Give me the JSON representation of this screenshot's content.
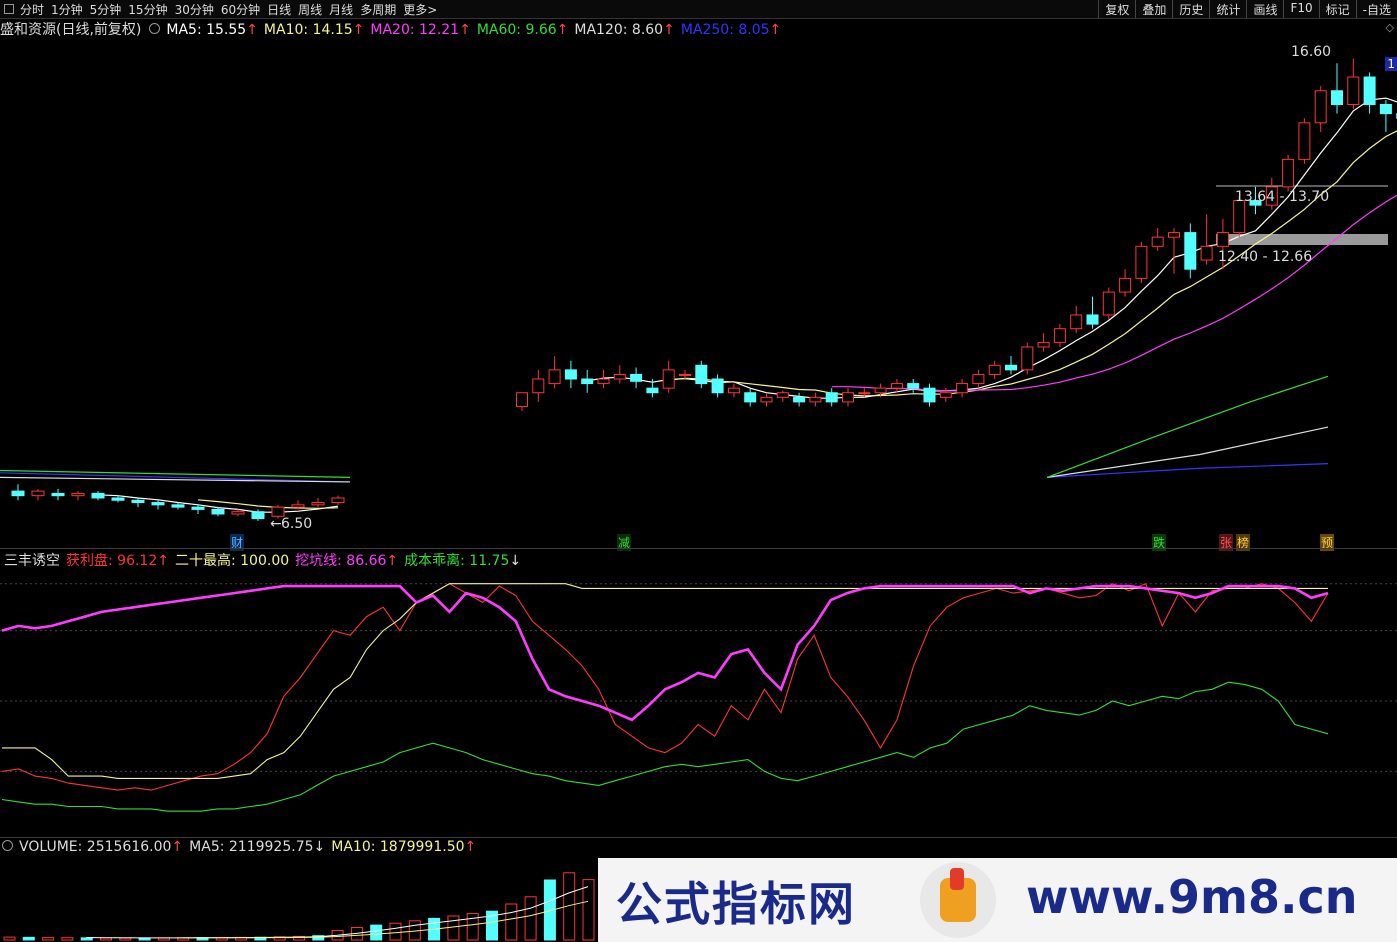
{
  "toolbar": {
    "tabs": [
      "分时",
      "1分钟",
      "5分钟",
      "15分钟",
      "30分钟",
      "60分钟",
      "日线",
      "周线",
      "月线",
      "多周期",
      "更多>"
    ],
    "active_tab": "日线",
    "right_tools": [
      "复权",
      "叠加",
      "历史",
      "统计",
      "画线",
      "F10",
      "标记",
      "-自选"
    ]
  },
  "price_pane": {
    "title": "盛和资源(日线,前复权)",
    "ma": [
      {
        "label": "MA5: 15.55",
        "arrow": "↑",
        "color": "#ffffff"
      },
      {
        "label": "MA10: 14.15",
        "arrow": "↑",
        "color": "#f5f58a"
      },
      {
        "label": "MA20: 12.21",
        "arrow": "↑",
        "color": "#ff3cff"
      },
      {
        "label": "MA60: 9.66",
        "arrow": "↑",
        "color": "#33dd33"
      },
      {
        "label": "MA120: 8.60",
        "arrow": "↑",
        "color": "#dddddd"
      },
      {
        "label": "MA250: 8.05",
        "arrow": "↑",
        "color": "#3333ff"
      }
    ],
    "high_label": "16.60",
    "low_label": "6.50",
    "zone1": "13.64 - 13.70",
    "zone2": "12.40 - 12.66",
    "right_edge_label": "1"
  },
  "events": [
    {
      "text": "财",
      "color": "#5ab4ff"
    },
    {
      "text": "减",
      "color": "#33dd33"
    },
    {
      "text": "跌",
      "color": "#33dd33"
    },
    {
      "text": "张",
      "color": "#ff5555"
    },
    {
      "text": "榜",
      "color": "#ffcc33"
    },
    {
      "text": "预",
      "color": "#ffcc33"
    }
  ],
  "indicator_pane": {
    "name": "三丰诱空",
    "items": [
      {
        "label": "获利盘: 96.12",
        "arrow": "↑",
        "color": "#ff3333"
      },
      {
        "label": "二十最高: 100.00",
        "arrow": "",
        "color": "#f5f58a"
      },
      {
        "label": "挖坑线: 86.66",
        "arrow": "↑",
        "color": "#ff3cff"
      },
      {
        "label": "成本乖离: 11.75",
        "arrow": "↓",
        "color": "#33dd33"
      }
    ]
  },
  "volume_pane": {
    "items": [
      {
        "label": "VOLUME: 2515616.00",
        "arrow": "↑",
        "color": "#dddddd"
      },
      {
        "label": "MA5: 2119925.75",
        "arrow": "↓",
        "color": "#dddddd"
      },
      {
        "label": "MA10: 1879991.50",
        "arrow": "↑",
        "color": "#f5f58a"
      }
    ]
  },
  "watermark": {
    "left_text": "公式指标网",
    "right_text": "www.9m8.cn",
    "logo_text": "www.9m8.cn"
  },
  "colors": {
    "up": "#ff3333",
    "down": "#54ffff",
    "ma5": "#ffffff",
    "ma10": "#f5f58a",
    "ma20": "#ff3cff",
    "ma60": "#33dd33",
    "ma120": "#dddddd",
    "ma250": "#3333ff"
  },
  "chart_data": [
    {
      "type": "candlestick",
      "title": "盛和资源(日线,前复权)",
      "candles": [
        {
          "o": 7.15,
          "h": 7.3,
          "c": 7.05,
          "l": 6.95
        },
        {
          "o": 7.05,
          "h": 7.2,
          "c": 7.15,
          "l": 6.95
        },
        {
          "o": 7.1,
          "h": 7.2,
          "c": 7.05,
          "l": 6.95
        },
        {
          "o": 7.05,
          "h": 7.15,
          "c": 7.1,
          "l": 6.95
        },
        {
          "o": 7.1,
          "h": 7.15,
          "c": 7.0,
          "l": 6.95
        },
        {
          "o": 7.0,
          "h": 7.05,
          "c": 6.95,
          "l": 6.9
        },
        {
          "o": 6.95,
          "h": 7.0,
          "c": 6.9,
          "l": 6.8
        },
        {
          "o": 6.9,
          "h": 6.95,
          "c": 6.85,
          "l": 6.75
        },
        {
          "o": 6.85,
          "h": 6.9,
          "c": 6.8,
          "l": 6.75
        },
        {
          "o": 6.8,
          "h": 6.85,
          "c": 6.75,
          "l": 6.65
        },
        {
          "o": 6.75,
          "h": 6.8,
          "c": 6.65,
          "l": 6.6
        },
        {
          "o": 6.65,
          "h": 6.75,
          "c": 6.7,
          "l": 6.6
        },
        {
          "o": 6.7,
          "h": 6.75,
          "c": 6.55,
          "l": 6.5
        },
        {
          "o": 6.6,
          "h": 6.85,
          "c": 6.8,
          "l": 6.55
        },
        {
          "o": 6.8,
          "h": 6.95,
          "c": 6.85,
          "l": 6.75
        },
        {
          "o": 6.85,
          "h": 7.0,
          "c": 6.9,
          "l": 6.8
        },
        {
          "o": 6.9,
          "h": 7.05,
          "c": 7.0,
          "l": 6.85
        },
        {
          "o": 9.0,
          "h": 9.2,
          "c": 9.3,
          "l": 8.9
        },
        {
          "o": 9.3,
          "h": 9.8,
          "c": 9.6,
          "l": 9.1
        },
        {
          "o": 9.5,
          "h": 10.1,
          "c": 9.8,
          "l": 9.4
        },
        {
          "o": 9.8,
          "h": 10.0,
          "c": 9.6,
          "l": 9.4
        },
        {
          "o": 9.6,
          "h": 9.8,
          "c": 9.5,
          "l": 9.3
        },
        {
          "o": 9.5,
          "h": 9.8,
          "c": 9.6,
          "l": 9.4
        },
        {
          "o": 9.6,
          "h": 9.9,
          "c": 9.7,
          "l": 9.5
        },
        {
          "o": 9.7,
          "h": 9.85,
          "c": 9.55,
          "l": 9.4
        },
        {
          "o": 9.4,
          "h": 9.6,
          "c": 9.3,
          "l": 9.2
        },
        {
          "o": 9.4,
          "h": 10.0,
          "c": 9.8,
          "l": 9.3
        },
        {
          "o": 9.7,
          "h": 9.8,
          "c": 9.7,
          "l": 9.6
        },
        {
          "o": 9.9,
          "h": 10.0,
          "c": 9.5,
          "l": 9.4
        },
        {
          "o": 9.6,
          "h": 9.7,
          "c": 9.3,
          "l": 9.2
        },
        {
          "o": 9.3,
          "h": 9.5,
          "c": 9.4,
          "l": 9.2
        },
        {
          "o": 9.3,
          "h": 9.4,
          "c": 9.1,
          "l": 9.0
        },
        {
          "o": 9.1,
          "h": 9.3,
          "c": 9.2,
          "l": 9.0
        },
        {
          "o": 9.2,
          "h": 9.35,
          "c": 9.3,
          "l": 9.1
        },
        {
          "o": 9.2,
          "h": 9.3,
          "c": 9.1,
          "l": 9.0
        },
        {
          "o": 9.1,
          "h": 9.3,
          "c": 9.2,
          "l": 9.0
        },
        {
          "o": 9.3,
          "h": 9.4,
          "c": 9.1,
          "l": 9.0
        },
        {
          "o": 9.1,
          "h": 9.4,
          "c": 9.3,
          "l": 9.0
        },
        {
          "o": 9.3,
          "h": 9.4,
          "c": 9.3,
          "l": 9.2
        },
        {
          "o": 9.3,
          "h": 9.5,
          "c": 9.4,
          "l": 9.2
        },
        {
          "o": 9.4,
          "h": 9.6,
          "c": 9.5,
          "l": 9.3
        },
        {
          "o": 9.5,
          "h": 9.6,
          "c": 9.4,
          "l": 9.3
        },
        {
          "o": 9.4,
          "h": 9.5,
          "c": 9.1,
          "l": 9.0
        },
        {
          "o": 9.2,
          "h": 9.4,
          "c": 9.3,
          "l": 9.1
        },
        {
          "o": 9.3,
          "h": 9.6,
          "c": 9.5,
          "l": 9.2
        },
        {
          "o": 9.5,
          "h": 9.8,
          "c": 9.7,
          "l": 9.4
        },
        {
          "o": 9.7,
          "h": 10.0,
          "c": 9.9,
          "l": 9.6
        },
        {
          "o": 9.9,
          "h": 10.1,
          "c": 9.8,
          "l": 9.7
        },
        {
          "o": 9.8,
          "h": 10.4,
          "c": 10.3,
          "l": 9.7
        },
        {
          "o": 10.3,
          "h": 10.6,
          "c": 10.4,
          "l": 10.2
        },
        {
          "o": 10.4,
          "h": 10.8,
          "c": 10.7,
          "l": 10.3
        },
        {
          "o": 10.7,
          "h": 11.2,
          "c": 11.0,
          "l": 10.6
        },
        {
          "o": 11.0,
          "h": 11.4,
          "c": 10.8,
          "l": 10.7
        },
        {
          "o": 11.0,
          "h": 11.6,
          "c": 11.5,
          "l": 10.9
        },
        {
          "o": 11.5,
          "h": 12.0,
          "c": 11.8,
          "l": 11.4
        },
        {
          "o": 11.8,
          "h": 12.6,
          "c": 12.5,
          "l": 11.7
        },
        {
          "o": 12.5,
          "h": 12.9,
          "c": 12.7,
          "l": 12.4
        },
        {
          "o": 12.7,
          "h": 12.9,
          "c": 12.8,
          "l": 11.9
        },
        {
          "o": 12.8,
          "h": 13.0,
          "c": 12.0,
          "l": 11.8
        },
        {
          "o": 12.2,
          "h": 13.2,
          "c": 12.5,
          "l": 12.1
        },
        {
          "o": 12.5,
          "h": 13.1,
          "c": 12.8,
          "l": 12.0
        },
        {
          "o": 12.8,
          "h": 13.6,
          "c": 13.5,
          "l": 12.7
        },
        {
          "o": 13.5,
          "h": 13.8,
          "c": 13.4,
          "l": 13.2
        },
        {
          "o": 13.4,
          "h": 14.0,
          "c": 13.8,
          "l": 13.3
        },
        {
          "o": 13.8,
          "h": 14.5,
          "c": 14.4,
          "l": 13.7
        },
        {
          "o": 14.4,
          "h": 15.3,
          "c": 15.2,
          "l": 14.3
        },
        {
          "o": 15.2,
          "h": 16.0,
          "c": 15.9,
          "l": 15.0
        },
        {
          "o": 15.9,
          "h": 16.5,
          "c": 15.6,
          "l": 15.4
        },
        {
          "o": 15.6,
          "h": 16.6,
          "c": 16.2,
          "l": 15.5
        },
        {
          "o": 16.2,
          "h": 16.3,
          "c": 15.6,
          "l": 15.4
        },
        {
          "o": 15.6,
          "h": 15.7,
          "c": 15.4,
          "l": 15.0
        },
        {
          "o": 15.4,
          "h": 15.6,
          "c": 15.3,
          "l": 14.7
        },
        {
          "o": 15.3,
          "h": 15.5,
          "c": 15.2,
          "l": 15.0
        },
        {
          "o": 15.2,
          "h": 16.2,
          "c": 16.1,
          "l": 15.1
        },
        {
          "o": 16.1,
          "h": 16.3,
          "c": 16.0,
          "l": 15.5
        }
      ],
      "ylim": [
        6.3,
        16.9
      ],
      "labels": {
        "high": "16.60",
        "low": "6.50"
      }
    },
    {
      "type": "line",
      "name": "三丰诱空",
      "ylim": [
        -5,
        105
      ],
      "series": [
        {
          "name": "获利盘",
          "color": "#ff3333",
          "values": [
            20,
            21,
            18,
            17,
            15,
            14,
            13,
            12,
            13,
            12,
            14,
            16,
            18,
            19,
            23,
            28,
            36,
            52,
            60,
            70,
            80,
            78,
            86,
            90,
            80,
            92,
            96,
            100,
            96,
            92,
            99,
            95,
            84,
            78,
            72,
            65,
            55,
            40,
            35,
            30,
            28,
            32,
            40,
            35,
            48,
            42,
            55,
            45,
            68,
            78,
            60,
            52,
            42,
            30,
            42,
            65,
            82,
            90,
            94,
            96,
            98,
            96,
            97,
            98,
            96,
            94,
            95,
            100,
            97,
            100,
            82,
            96,
            88,
            97,
            98,
            98,
            100,
            98,
            92,
            84,
            96
          ]
        },
        {
          "name": "二十最高",
          "color": "#f5f58a",
          "values": [
            30,
            30,
            30,
            25,
            18,
            18,
            18,
            17,
            17,
            17,
            17,
            17,
            17,
            17,
            18,
            19,
            25,
            28,
            35,
            45,
            55,
            60,
            72,
            80,
            85,
            92,
            96,
            100,
            100,
            100,
            100,
            100,
            100,
            100,
            100,
            98,
            98,
            98,
            98,
            98,
            98,
            98,
            98,
            98,
            98,
            98,
            98,
            98,
            98,
            98,
            98,
            98,
            98,
            98,
            98,
            98,
            98,
            98,
            98,
            98,
            98,
            98,
            98,
            98,
            98,
            98,
            98,
            98,
            98,
            98,
            98,
            98,
            98,
            98,
            98,
            98,
            98,
            98,
            98,
            98,
            98
          ]
        },
        {
          "name": "挖坑线",
          "color": "#ff3cff",
          "values": [
            80,
            82,
            81,
            82,
            84,
            86,
            88,
            89,
            90,
            91,
            92,
            93,
            94,
            95,
            96,
            97,
            98,
            99,
            99,
            99,
            99,
            99,
            99,
            99,
            99,
            92,
            95,
            88,
            96,
            94,
            90,
            84,
            68,
            55,
            52,
            50,
            48,
            45,
            42,
            48,
            55,
            58,
            62,
            60,
            70,
            72,
            62,
            55,
            74,
            82,
            93,
            96,
            98,
            99,
            99,
            99,
            99,
            99,
            99,
            99,
            99,
            99,
            96,
            98,
            97,
            98,
            99,
            99,
            99,
            98,
            97,
            96,
            94,
            96,
            99,
            99,
            99,
            99,
            98,
            94,
            96
          ]
        },
        {
          "name": "成本乖离",
          "color": "#33dd33",
          "values": [
            8,
            7,
            6,
            6,
            5,
            5,
            5,
            4,
            4,
            4,
            3,
            3,
            3,
            4,
            4,
            5,
            6,
            8,
            10,
            14,
            18,
            20,
            22,
            24,
            28,
            30,
            32,
            30,
            28,
            25,
            23,
            21,
            19,
            18,
            16,
            15,
            14,
            16,
            18,
            20,
            22,
            23,
            22,
            23,
            24,
            25,
            20,
            17,
            16,
            18,
            20,
            22,
            24,
            26,
            28,
            26,
            30,
            32,
            38,
            40,
            42,
            44,
            48,
            46,
            45,
            44,
            46,
            50,
            48,
            50,
            52,
            51,
            54,
            55,
            58,
            57,
            55,
            50,
            40,
            38,
            36
          ]
        }
      ]
    },
    {
      "type": "bar",
      "name": "VOLUME",
      "values": [
        120000,
        110000,
        100000,
        95000,
        90000,
        85000,
        80000,
        85000,
        90000,
        95000,
        100000,
        105000,
        110000,
        115000,
        130000,
        150000,
        180000,
        400000,
        520000,
        620000,
        700000,
        800000,
        900000,
        1000000,
        1100000,
        1200000,
        1500000,
        1800000,
        2500000,
        2800000,
        2515616
      ],
      "ma5": 2119925.75,
      "ma10": 1879991.5
    }
  ]
}
